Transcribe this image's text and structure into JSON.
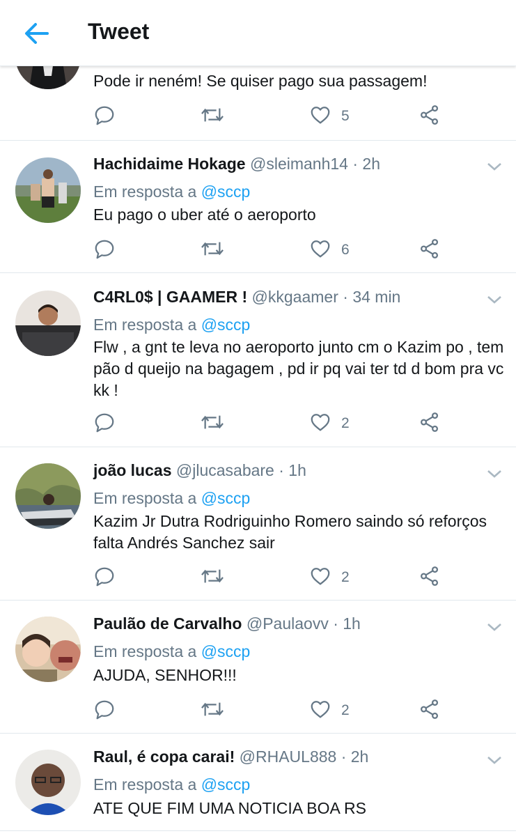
{
  "header": {
    "title": "Tweet"
  },
  "tweets": [
    {
      "text": "Pode ir neném! Se quiser pago sua passagem!",
      "like_count": "5"
    },
    {
      "name": "Hachidaime Hokage",
      "handle": "@sleimanh14",
      "time": "· 2h",
      "reply_prefix": "Em resposta a",
      "reply_to": "@sccp",
      "text": "Eu pago o uber até o aeroporto",
      "like_count": "6"
    },
    {
      "name": "C4RL0$ | GAAMER !",
      "handle": "@kkgaamer",
      "time": "· 34 min",
      "reply_prefix": "Em resposta a",
      "reply_to": "@sccp",
      "text": "Flw , a gnt te leva no aeroporto junto cm o Kazim po , tem pão d queijo na bagagem , pd ir pq vai ter td d bom pra vc kk !",
      "like_count": "2"
    },
    {
      "name": "joão lucas",
      "handle": "@jlucasabare",
      "time": "· 1h",
      "reply_prefix": "Em resposta a",
      "reply_to": "@sccp",
      "text": "Kazim Jr Dutra Rodriguinho Romero saindo só reforços falta Andrés Sanchez sair",
      "like_count": "2"
    },
    {
      "name": "Paulão de Carvalho",
      "handle": "@Paulaovv",
      "time": "· 1h",
      "reply_prefix": "Em resposta a",
      "reply_to": "@sccp",
      "text": "AJUDA, SENHOR!!!",
      "like_count": "2"
    },
    {
      "name": "Raul, é copa carai!",
      "handle": "@RHAUL888",
      "time": "· 2h",
      "reply_prefix": "Em resposta a",
      "reply_to": "@sccp",
      "text": "ATE QUE FIM UMA NOTICIA BOA RS"
    }
  ],
  "icons": {
    "back": "arrow-left-icon",
    "reply": "reply-icon",
    "retweet": "retweet-icon",
    "like": "heart-icon",
    "share": "share-icon",
    "caret": "chevron-down-icon"
  },
  "colors": {
    "accent": "#1da1f2",
    "secondary_text": "#657786",
    "icon": "#657786",
    "divider": "#e1e8ed"
  }
}
